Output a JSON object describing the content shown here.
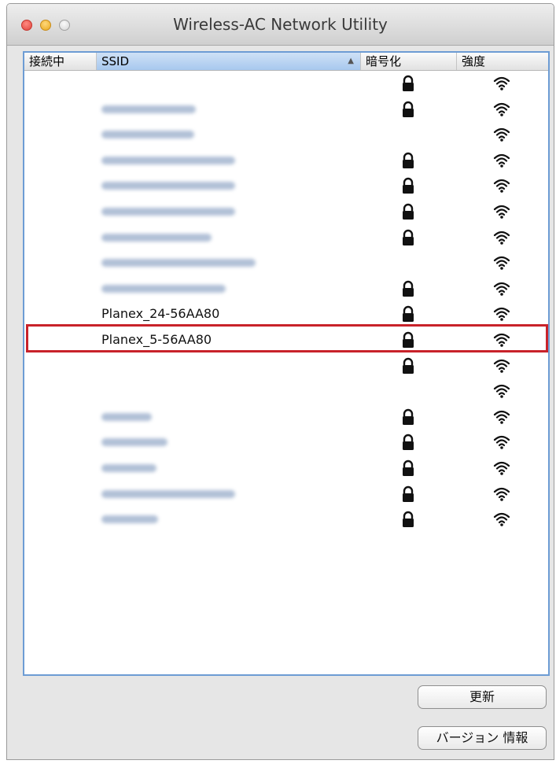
{
  "window": {
    "title": "Wireless-AC Network Utility"
  },
  "columns": {
    "connected": "接続中",
    "ssid": "SSID",
    "encryption": "暗号化",
    "strength": "強度"
  },
  "networks": [
    {
      "ssid": "",
      "blurred": false,
      "locked": true,
      "signal": "wifi-strong"
    },
    {
      "ssid": "",
      "blurred": true,
      "locked": true,
      "signal": "wifi-strong"
    },
    {
      "ssid": "",
      "blurred": true,
      "locked": false,
      "signal": "wifi-strong"
    },
    {
      "ssid": "",
      "blurred": true,
      "locked": true,
      "signal": "wifi-strong"
    },
    {
      "ssid": "",
      "blurred": true,
      "locked": true,
      "signal": "wifi-strong"
    },
    {
      "ssid": "",
      "blurred": true,
      "locked": true,
      "signal": "wifi-strong"
    },
    {
      "ssid": "",
      "blurred": true,
      "locked": true,
      "signal": "wifi-strong"
    },
    {
      "ssid": "",
      "blurred": true,
      "locked": false,
      "signal": "wifi-strong"
    },
    {
      "ssid": "",
      "blurred": true,
      "locked": true,
      "signal": "wifi-strong"
    },
    {
      "ssid": "Planex_24-56AA80",
      "blurred": false,
      "locked": true,
      "signal": "wifi-strong"
    },
    {
      "ssid": "Planex_5-56AA80",
      "blurred": false,
      "locked": true,
      "signal": "wifi-strong",
      "highlighted": true
    },
    {
      "ssid": "",
      "blurred": true,
      "locked": true,
      "signal": "wifi-strong"
    },
    {
      "ssid": "",
      "blurred": true,
      "locked": false,
      "signal": "wifi-strong"
    },
    {
      "ssid": "",
      "blurred": true,
      "locked": true,
      "signal": "wifi-strong"
    },
    {
      "ssid": "",
      "blurred": true,
      "locked": true,
      "signal": "wifi-strong"
    },
    {
      "ssid": "",
      "blurred": true,
      "locked": true,
      "signal": "wifi-strong"
    },
    {
      "ssid": "",
      "blurred": true,
      "locked": true,
      "signal": "wifi-strong"
    },
    {
      "ssid": "",
      "blurred": true,
      "locked": true,
      "signal": "wifi-strong"
    }
  ],
  "buttons": {
    "update": "更新",
    "version": "バージョン 情報"
  },
  "colors": {
    "highlight": "#c8222a",
    "focus_ring": "#6d9cd4"
  }
}
